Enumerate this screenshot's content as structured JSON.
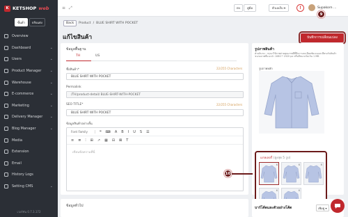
{
  "brand": {
    "name": "KETSHOP",
    "accent": "web",
    "mark": "K"
  },
  "modes": [
    {
      "label": "ขั้นต่ำ",
      "active": true
    },
    {
      "label": "ปรับแต่ง",
      "active": false
    }
  ],
  "sidebar": {
    "items": [
      {
        "label": "Overview",
        "chevron": false
      },
      {
        "label": "Dashboard",
        "chevron": true
      },
      {
        "label": "Users",
        "chevron": true
      },
      {
        "label": "Product Manager",
        "chevron": true
      },
      {
        "label": "Warehouse",
        "chevron": true
      },
      {
        "label": "E-commerce",
        "chevron": true
      },
      {
        "label": "Marketing",
        "chevron": true
      },
      {
        "label": "Delivery Manager",
        "chevron": true
      },
      {
        "label": "Blog Manager",
        "chevron": true
      },
      {
        "label": "Media",
        "chevron": false
      },
      {
        "label": "Extension",
        "chevron": false
      },
      {
        "label": "Email",
        "chevron": false
      },
      {
        "label": "History Logs",
        "chevron": false
      },
      {
        "label": "Setting CMS",
        "chevron": true
      }
    ],
    "version": "เวอร์ชัน 0.7.3.172"
  },
  "topbar": {
    "menu_glyph": "≡",
    "expand_glyph": "⤢",
    "lang": "คู่มือ",
    "lang_flag": "EN",
    "store": "ตัวเลเก็บ",
    "alert_glyph": "!",
    "user": "Supakorn ..."
  },
  "breadcrumb": {
    "back": "Back",
    "items": [
      "Product",
      "BLUE SHIRT WITH POCKET"
    ],
    "separator": "/"
  },
  "page": {
    "title": "แก้ไขสินค้า",
    "save_label": "บันทึกการเปลี่ยนแปลง"
  },
  "badges": {
    "save": "9",
    "gallery": "10"
  },
  "basic": {
    "section": "ข้อมูลพื้นฐาน",
    "tabs": [
      {
        "label": "TH",
        "active": true
      },
      {
        "label": "US",
        "active": false
      }
    ],
    "name_label": "ชื่อสินค้า*",
    "name_value": "BLUE SHIRT WITH POCKET",
    "name_counter": "22/255 Characters",
    "permalink_label": "Permalink",
    "permalink_value": "/TH/product-detail/ BLUE-SHIRT-WITH-POCKET",
    "seo_label": "SEO TITLE*",
    "seo_value": "BLUE SHIRT WITH POCKET",
    "seo_counter": "22/255 Characters",
    "desc_label": "ข้อมูลสินค้าอย่างสั้น",
    "font_family": "Font Family",
    "editor_placeholder": "เขียนข้อความที่นี่",
    "toolbar_row1": [
      "❝",
      "⌨",
      "A",
      "B",
      "I",
      "U",
      "S",
      "☰"
    ],
    "toolbar_row2": [
      "≡",
      "≣",
      "⫶",
      "⊞",
      "↗",
      "▦",
      "⊟",
      "⊠",
      "T"
    ]
  },
  "general": {
    "section": "ข้อมูลทั่วไป"
  },
  "images": {
    "section": "รูปภาพสินค้า",
    "note_line1": "คำอธิบาย : กรุณาใช้ภาพถ่ายคุณภาพดีที่มีความละเอียดชัดเจนและสีตรงกับสินค้า",
    "note_line2": "ขนาดภาพที่แนะนำ 1080 * 1920 px หรือมีขนาดไม่เกิน 1 MB",
    "main_label": "รูปภาพหลัก",
    "gallery_title": "แกลเลอรี่",
    "gallery_sub": "(สูงสุด 5 รูป)",
    "remove_glyph": "x",
    "thumb_count": 5
  },
  "barcode": {
    "section": "บาร์โค้ดและตัวอย่างโค้ด",
    "action": "เพิ่มดู"
  },
  "colors": {
    "accent": "#c0282d",
    "sidebar_bg": "#2b2f36",
    "badge": "#6b1a1a",
    "shirt": "#b7c4e4"
  }
}
